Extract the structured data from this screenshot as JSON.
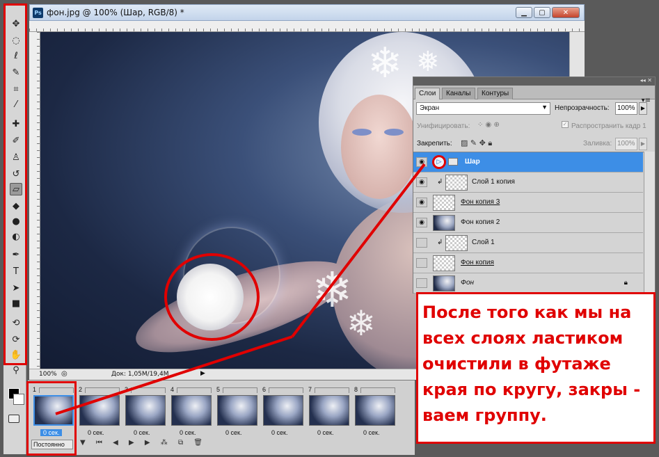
{
  "document": {
    "title": "фон.jpg @ 100% (Шар, RGB/8) *",
    "zoom": "100%",
    "doc_size": "Док: 1,05M/19,4M"
  },
  "app_icon": "Ps",
  "toolbox": {
    "tools": [
      "move-tool",
      "marquee-tool",
      "lasso-tool",
      "quick-selection-tool",
      "crop-tool",
      "eyedropper-tool",
      "healing-brush-tool",
      "brush-tool",
      "clone-stamp-tool",
      "history-brush-tool",
      "eraser-tool",
      "paint-bucket-tool",
      "blur-tool",
      "dodge-tool",
      "pen-tool",
      "type-tool",
      "path-selection-tool",
      "rectangle-tool",
      "3d-rotate-tool",
      "3d-orbit-tool",
      "hand-tool",
      "zoom-tool"
    ],
    "active_tool": "eraser-tool"
  },
  "layers_panel": {
    "tabs": [
      "Слои",
      "Каналы",
      "Контуры"
    ],
    "active_tab": "Слои",
    "blend_mode": "Экран",
    "opacity_label": "Непрозрачность:",
    "opacity_value": "100%",
    "unify_label": "Унифицировать:",
    "propagate_label": "Распространить кадр 1",
    "lock_label": "Закрепить:",
    "fill_label": "Заливка:",
    "fill_value": "100%",
    "layers": [
      {
        "name": "Шар",
        "type": "group",
        "visible": true,
        "selected": true
      },
      {
        "name": "Слой 1 копия",
        "type": "clipped-transparent",
        "visible": true
      },
      {
        "name": "Фон копия 3",
        "type": "transparent",
        "visible": true
      },
      {
        "name": "Фон копия 2",
        "type": "photo",
        "visible": true
      },
      {
        "name": "Слой 1",
        "type": "clipped-transparent",
        "visible": false
      },
      {
        "name": "Фон копия",
        "type": "transparent",
        "visible": false
      },
      {
        "name": "Фон",
        "type": "photo-locked",
        "visible": false
      }
    ]
  },
  "annotation": {
    "text": "После того как мы на всех слоях ластиком очистили в футаже края по кругу, закры - ваем группу."
  },
  "timeline": {
    "frames": [
      {
        "num": "1",
        "time": "0 сек."
      },
      {
        "num": "2",
        "time": "0 сек."
      },
      {
        "num": "3",
        "time": "0 сек."
      },
      {
        "num": "4",
        "time": "0 сек."
      },
      {
        "num": "5",
        "time": "0 сек."
      },
      {
        "num": "6",
        "time": "0 сек."
      },
      {
        "num": "7",
        "time": "0 сек."
      },
      {
        "num": "8",
        "time": "0 сек."
      }
    ],
    "selected_frame": 1,
    "loop_option": "Постоянно"
  },
  "colors": {
    "annotation_red": "#e00000",
    "selection_blue": "#3d8ee6"
  }
}
